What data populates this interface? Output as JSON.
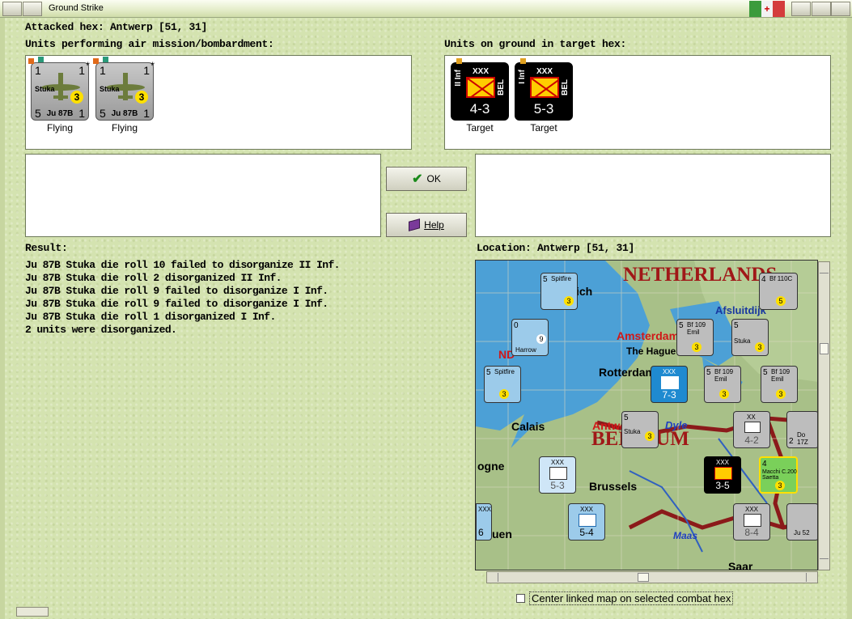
{
  "window": {
    "title": "Ground Strike"
  },
  "header": {
    "attacked_hex": "Attacked hex: Antwerp  [51, 31]"
  },
  "air_panel": {
    "label": "Units performing air mission/bombardment:",
    "units": [
      {
        "name": "Stuka",
        "model": "Ju 87B",
        "top_left": "1",
        "top_right": "1",
        "bottom_left": "5",
        "bottom_right": "1",
        "badge": "3",
        "star": "*",
        "status": "Flying"
      },
      {
        "name": "Stuka",
        "model": "Ju 87B",
        "top_left": "1",
        "top_right": "1",
        "bottom_left": "5",
        "bottom_right": "1",
        "badge": "3",
        "star": "*",
        "status": "Flying"
      }
    ]
  },
  "ground_panel": {
    "label": "Units on ground in target hex:",
    "units": [
      {
        "name": "II Inf",
        "size": "XXX",
        "nation": "BEL",
        "strength": "4-3",
        "status": "Target"
      },
      {
        "name": "I Inf",
        "size": "XXX",
        "nation": "BEL",
        "strength": "5-3",
        "status": "Target"
      }
    ]
  },
  "buttons": {
    "ok": "OK",
    "help": "Help"
  },
  "result": {
    "label": "Result:",
    "lines": [
      "Ju 87B Stuka die roll 10 failed to disorganize II Inf.",
      "Ju 87B Stuka die roll 2 disorganized II Inf.",
      "Ju 87B Stuka die roll 9 failed to disorganize I Inf.",
      "Ju 87B Stuka die roll 9 failed to disorganize I Inf.",
      "Ju 87B Stuka die roll 1 disorganized I Inf.",
      "2 units were disorganized."
    ]
  },
  "location": {
    "label": "Location:  Antwerp  [51, 31]",
    "map_labels": {
      "netherlands": "NETHERLANDS",
      "belgium": "BELGIUM",
      "amsterdam": "Amsterdam",
      "the_hague": "The Hague",
      "rotterdam": "Rotterdam",
      "calais": "Calais",
      "antwerp": "Antwerp",
      "dyle": "Dyle",
      "brussels": "Brussels",
      "maas": "Maas",
      "afsluitdijk": "Afsluitdijk",
      "ich": "ich",
      "ogne": "ogne",
      "uen": "uen",
      "saar": "Saar",
      "nd": "ND"
    },
    "map_counters": [
      {
        "name": "Spitfire",
        "value": "5",
        "badge": "3"
      },
      {
        "name": "Bf 110C",
        "value": "4",
        "badge": "5"
      },
      {
        "name": "Harrow",
        "value": "0",
        "badge": "9"
      },
      {
        "name": "Bf 109 Emil",
        "value": "5",
        "badge": "3"
      },
      {
        "name": "Stuka",
        "value": "5",
        "badge": "3"
      },
      {
        "name": "Spitfire",
        "value": "5",
        "badge": "3"
      },
      {
        "name": "XXX",
        "value": "7-3",
        "badge": ""
      },
      {
        "name": "Bf 109 Emil",
        "value": "5",
        "badge": "3"
      },
      {
        "name": "Bf 109 Emil",
        "value": "5",
        "badge": "3"
      },
      {
        "name": "Stuka",
        "value": "5",
        "badge": "3"
      },
      {
        "name": "XX",
        "value": "4-2",
        "badge": ""
      },
      {
        "name": "Do 17Z",
        "value": "2",
        "badge": ""
      },
      {
        "name": "XXX",
        "value": "5-3",
        "badge": ""
      },
      {
        "name": "XXX",
        "value": "3-5",
        "badge": ""
      },
      {
        "name": "Macchi C.200 Saetta",
        "value": "4",
        "badge": "3"
      },
      {
        "name": "XXX",
        "value": "5-4",
        "badge": ""
      },
      {
        "name": "XXX",
        "value": "8-4",
        "badge": ""
      },
      {
        "name": "Ju 52",
        "value": "",
        "badge": ""
      },
      {
        "name": "XXX",
        "value": "6",
        "badge": ""
      }
    ]
  },
  "checkbox": {
    "label": "Center linked map on selected combat hex",
    "checked": false
  },
  "colors": {
    "panel_bg": "#d4e3b0",
    "sea": "#4ca0d6",
    "land": "#a8c088",
    "border_red": "#8b1a1a",
    "allied_counter": "#9ccbea",
    "axis_counter": "#bdbdbd",
    "badge_yellow": "#ffe000"
  }
}
